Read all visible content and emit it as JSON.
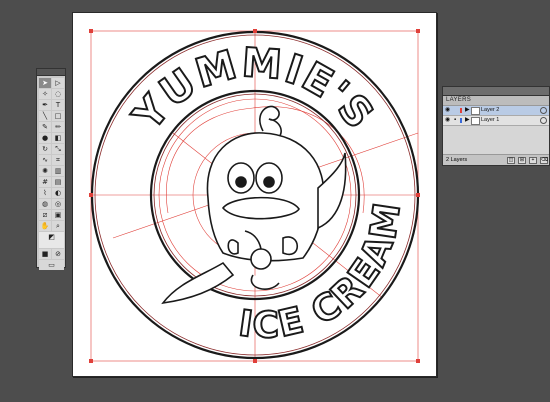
{
  "artwork": {
    "top_text": "YUMMIE'S",
    "bottom_text": "ICE CREAM",
    "stroke_color": "#1a1a1a",
    "guide_color": "#e0403a"
  },
  "layers_panel": {
    "tab_label": "LAYERS",
    "layers": [
      {
        "name": "Layer 2",
        "swatch": "#e0403a",
        "selected": true
      },
      {
        "name": "Layer 1",
        "swatch": "#3a6ad8",
        "selected": false
      }
    ],
    "footer_count": "2 Layers"
  },
  "tools": [
    "selection-tool",
    "direct-selection-tool",
    "magic-wand-tool",
    "lasso-tool",
    "pen-tool",
    "type-tool",
    "line-tool",
    "rectangle-tool",
    "paintbrush-tool",
    "pencil-tool",
    "blob-brush-tool",
    "eraser-tool",
    "rotate-tool",
    "scale-tool",
    "warp-tool",
    "free-transform-tool",
    "symbol-sprayer-tool",
    "graph-tool",
    "mesh-tool",
    "gradient-tool",
    "eyedropper-tool",
    "blend-tool",
    "live-paint-tool",
    "live-paint-selection-tool",
    "slice-tool",
    "artboard-tool",
    "hand-tool",
    "zoom-tool"
  ]
}
